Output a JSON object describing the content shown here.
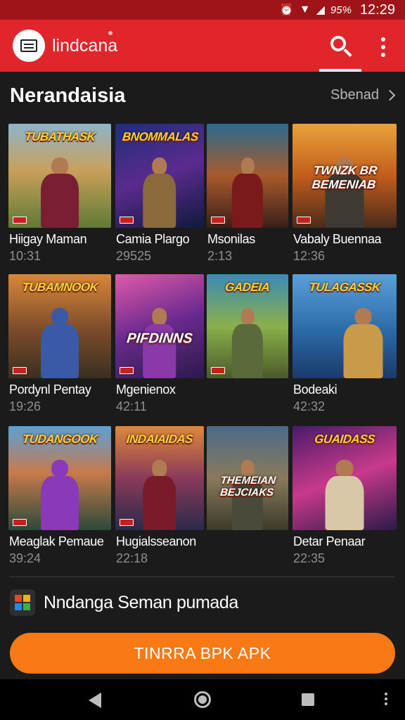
{
  "status_bar": {
    "battery": "95%",
    "time": "12:29"
  },
  "app_bar": {
    "title": "lindcana"
  },
  "section": {
    "title": "Nerandaisia",
    "see_more": "Sbenad"
  },
  "games": [
    {
      "title": "Hiigay Maman",
      "time": "10:31",
      "banner": "TUBATHASK",
      "sub": ""
    },
    {
      "title": "Camia Plargo",
      "time": "29525",
      "banner": "BNOMMALAS",
      "sub": ""
    },
    {
      "title": "Msonilas",
      "time": "2:13",
      "banner": "",
      "sub": ""
    },
    {
      "title": "Vabaly Buennaa",
      "time": "12:36",
      "banner": "",
      "sub": "TWNZK BR BEMENIAB"
    },
    {
      "title": "Pordynl Pentay",
      "time": "19:26",
      "banner": "TUBAMNOOK",
      "sub": ""
    },
    {
      "title": "Mgenienox",
      "time": "42:11",
      "banner": "",
      "sub": "PIFDINNS"
    },
    {
      "title": "",
      "time": "",
      "banner": "GADEIA",
      "sub": ""
    },
    {
      "title": "Bodeaki",
      "time": "42:32",
      "banner": "TULAGASSK",
      "sub": ""
    },
    {
      "title": "Meaglak Pemaue",
      "time": "39:24",
      "banner": "TUDANGOOK",
      "sub": ""
    },
    {
      "title": "Hugialsseanon",
      "time": "22:18",
      "banner": "INDAIAIDAS",
      "sub": ""
    },
    {
      "title": "",
      "time": "",
      "banner": "",
      "sub": "THEMEIAN BEJCIAKS"
    },
    {
      "title": "Detar Penaar",
      "time": "22:35",
      "banner": "GUAIDASS",
      "sub": ""
    }
  ],
  "promo": {
    "text": "Nndanga Seman pumada"
  },
  "cta": {
    "label": "TINRRA BPK APK"
  },
  "colors": {
    "status_bar": "#9e1418",
    "app_bar": "#e0262b",
    "background": "#1b1b1b",
    "cta": "#f97a14",
    "muted_text": "#8f8f8f"
  },
  "icons": [
    "alarm-icon",
    "wifi-icon",
    "signal-icon",
    "app-logo-icon",
    "search-icon",
    "overflow-menu-icon",
    "chevron-right-icon",
    "back-icon",
    "home-icon",
    "recents-icon"
  ]
}
